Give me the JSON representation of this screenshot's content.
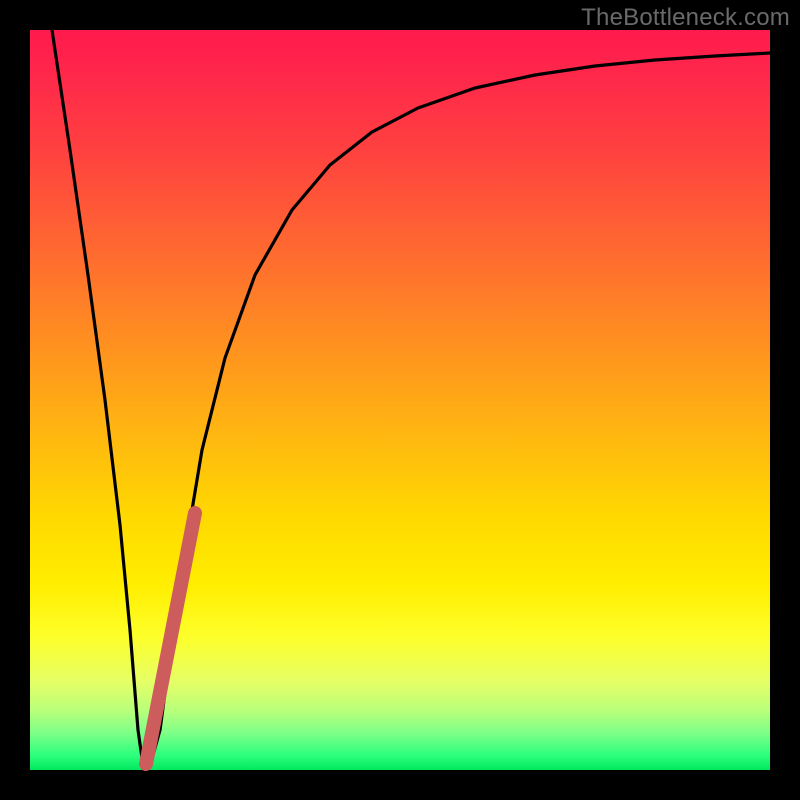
{
  "watermark": "TheBottleneck.com",
  "chart_data": {
    "type": "line",
    "title": "",
    "xlabel": "",
    "ylabel": "",
    "xlim": [
      0,
      100
    ],
    "ylim": [
      0,
      100
    ],
    "series": [
      {
        "name": "curve",
        "x": [
          3,
          5,
          7,
          9,
          11,
          12.5,
          14,
          15,
          17,
          20,
          23,
          26,
          30,
          35,
          40,
          46,
          52,
          60,
          68,
          76,
          84,
          92,
          100
        ],
        "y": [
          100,
          83,
          67,
          50,
          33,
          18,
          5,
          0.5,
          5,
          26,
          44,
          56,
          67,
          76,
          82,
          86.5,
          89.5,
          92,
          93.8,
          95,
          95.8,
          96.3,
          96.8
        ]
      }
    ],
    "highlight_segment": {
      "name": "overlay-pink-segment",
      "x": [
        14.5,
        21.5
      ],
      "y": [
        1,
        35
      ],
      "color": "#cd5c5c",
      "width": 14
    },
    "gradient_stops": [
      {
        "pos": 0,
        "color": "#ff1a4d"
      },
      {
        "pos": 50,
        "color": "#ffc400"
      },
      {
        "pos": 80,
        "color": "#fffb20"
      },
      {
        "pos": 100,
        "color": "#00e85e"
      }
    ]
  }
}
